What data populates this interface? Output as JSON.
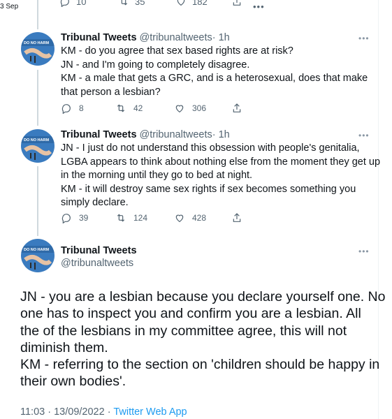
{
  "corner_date": "3 Sep",
  "top_row": {
    "reply_count": "10",
    "retweet_count": "35",
    "like_count": "182",
    "dots": "•••"
  },
  "tweets": [
    {
      "name": "Tribunal Tweets",
      "handle": "@tribunaltweets",
      "sep": "·",
      "time": "1h",
      "avatar_text": "DO NO HARM",
      "lines": [
        "KM - do you agree that sex based rights are at risk?",
        "JN - and I'm going to completely disagree.",
        "KM - a male that gets a GRC, and is a heterosexual, does that make",
        "that person a lesbian?"
      ],
      "reply_count": "8",
      "retweet_count": "42",
      "like_count": "306",
      "more": "•••"
    },
    {
      "name": "Tribunal Tweets",
      "handle": "@tribunaltweets",
      "sep": "·",
      "time": "1h",
      "avatar_text": "DO NO HARM",
      "lines": [
        "JN - I just do not understand this obsession with people's genitalia,",
        "LGBA appears to think about nothing else from the moment they get up",
        "in the morning until they go to bed at night.",
        "KM - it will destroy same sex rights if sex becomes something you",
        "simply declare."
      ],
      "reply_count": "39",
      "retweet_count": "124",
      "like_count": "428",
      "more": "•••"
    }
  ],
  "main_tweet": {
    "name": "Tribunal Tweets",
    "handle": "@tribunaltweets",
    "avatar_text": "DO NO HARM",
    "more": "•••",
    "lines": [
      "JN - you are a lesbian because you declare yourself one. No",
      "one has to inspect you and confirm you are a lesbian.  All",
      "the of the lesbians in my committee agree, this will not",
      "diminish them.",
      "KM - referring to the section on 'children should be happy in",
      "their own bodies'."
    ],
    "time": "11:03 · 13/09/2022 ·",
    "app": "Twitter Web App"
  },
  "colors": {
    "text": "#0f1419",
    "secondary": "#536471",
    "link": "#1d9bf0",
    "line": "#cfd9de",
    "avatar_bg": "#3a7bbf",
    "avatar_label": "#c0392b"
  }
}
